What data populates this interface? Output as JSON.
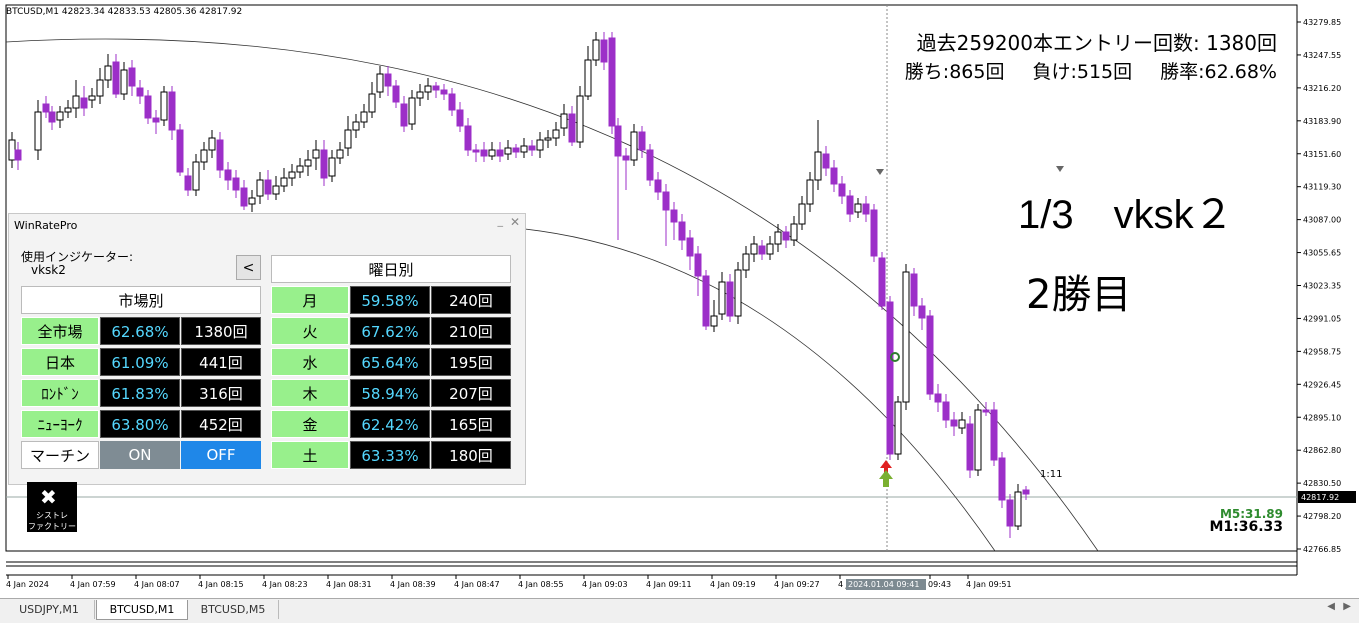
{
  "chart": {
    "symbol_header": "BTCUSD,M1  42823.34 42833.53 42805.36 42817.92",
    "stats_line1": "過去259200本エントリー回数: 1380回",
    "stats_wins": "勝ち:865回",
    "stats_losses": "負け:515回",
    "stats_rate": "勝率:62.68%",
    "big_label1": "1/3　vksk２",
    "big_label2": "2勝目",
    "m5_timer": "M5:31.89",
    "m1_timer": "M1:36.33",
    "countdown": "1:11",
    "current_price": "42817.92",
    "price_labels": [
      "43279.85",
      "43247.55",
      "43216.20",
      "43183.90",
      "43151.60",
      "43119.30",
      "43087.00",
      "43055.65",
      "43023.35",
      "42991.05",
      "42958.75",
      "42926.45",
      "42895.10",
      "42862.80",
      "42830.50",
      "42798.20",
      "42766.85"
    ],
    "time_labels": [
      "4 Jan 2024",
      "4 Jan 07:59",
      "4 Jan 08:07",
      "4 Jan 08:15",
      "4 Jan 08:23",
      "4 Jan 08:31",
      "4 Jan 08:39",
      "4 Jan 08:47",
      "4 Jan 08:55",
      "4 Jan 09:03",
      "4 Jan 09:11",
      "4 Jan 09:19",
      "4 Jan 09:27",
      "4 Jan",
      "09:43",
      "4 Jan 09:51"
    ],
    "crosshair_time": "2024.01.04 09:41",
    "bullish_color": "#000000",
    "bearish_color": "#9c2fc8"
  },
  "panel": {
    "title": "WinRatePro",
    "min": "_",
    "close": "✕",
    "indicator_label": "使用インジケーター:",
    "indicator_value": "vksk2",
    "back_button": "<",
    "market_header": "市場別",
    "weekday_header": "曜日別",
    "markets": [
      {
        "name": "全市場",
        "rate": "62.68%",
        "count": "1380回"
      },
      {
        "name": "日本",
        "rate": "61.09%",
        "count": "441回"
      },
      {
        "name": "ﾛﾝﾄﾞﾝ",
        "rate": "61.83%",
        "count": "316回"
      },
      {
        "name": "ﾆｭｰﾖｰｸ",
        "rate": "63.80%",
        "count": "452回"
      }
    ],
    "weekdays": [
      {
        "name": "月",
        "rate": "59.58%",
        "count": "240回"
      },
      {
        "name": "火",
        "rate": "67.62%",
        "count": "210回"
      },
      {
        "name": "水",
        "rate": "65.64%",
        "count": "195回"
      },
      {
        "name": "木",
        "rate": "58.94%",
        "count": "207回"
      },
      {
        "name": "金",
        "rate": "62.42%",
        "count": "165回"
      },
      {
        "name": "土",
        "rate": "63.33%",
        "count": "180回"
      }
    ],
    "martin_label": "マーチン",
    "martin_on": "ON",
    "martin_off": "OFF"
  },
  "logo": {
    "line1": "シストレ",
    "line2": "ファクトリー",
    "icon": "tools-icon"
  },
  "tabs": [
    "USDJPY,M1",
    "BTCUSD,M1",
    "BTCUSD,M5"
  ],
  "active_tab": "BTCUSD,M1"
}
